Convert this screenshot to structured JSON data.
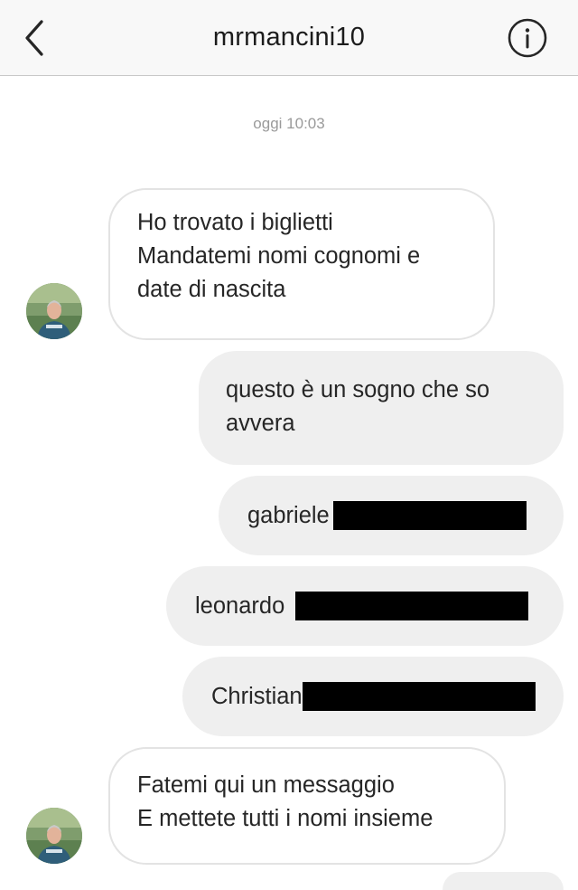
{
  "header": {
    "username": "mrmancini10",
    "back_icon": "chevron-left-icon",
    "info_icon": "info-circle-icon"
  },
  "conversation": {
    "timestamp": "oggi 10:03",
    "messages": [
      {
        "direction": "incoming",
        "lines": [
          "Ho trovato i biglietti",
          "Mandatemi nomi cognomi e",
          "date di nascita"
        ]
      },
      {
        "direction": "outgoing",
        "lines": [
          "questo è un sogno che so",
          "avvera"
        ]
      },
      {
        "direction": "outgoing",
        "text": "gabriele",
        "redacted": true
      },
      {
        "direction": "outgoing",
        "text": "leonardo",
        "redacted": true
      },
      {
        "direction": "outgoing",
        "text": "Christian",
        "redacted": true
      },
      {
        "direction": "incoming",
        "lines": [
          "Fatemi qui un messaggio",
          "E mettete tutti i nomi insieme"
        ]
      }
    ]
  },
  "colors": {
    "header_bg": "#f8f8f8",
    "incoming_border": "#e3e3e3",
    "outgoing_bg": "#efefef",
    "text": "#262626",
    "timestamp": "#9a9a9a",
    "redaction": "#000000"
  }
}
